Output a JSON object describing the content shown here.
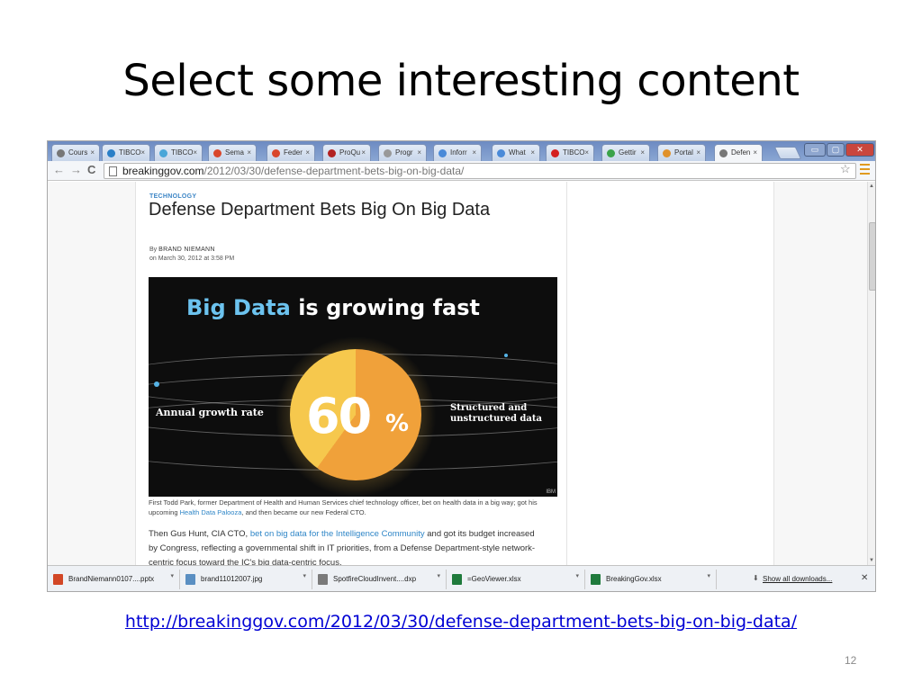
{
  "slide": {
    "title": "Select some interesting content",
    "link": "http://breakinggov.com/2012/03/30/defense-department-bets-big-on-big-data/",
    "page_number": "12"
  },
  "browser": {
    "tabs": [
      {
        "label": "Cours",
        "icon": "page-icon",
        "color": "#777777"
      },
      {
        "label": "TIBCO",
        "icon": "tibco-icon",
        "color": "#2a7fc7"
      },
      {
        "label": "TIBCO",
        "icon": "tibco-icon",
        "color": "#4aa6d8"
      },
      {
        "label": "Sema",
        "icon": "semantic-icon",
        "color": "#d9472b"
      },
      {
        "label": "Feder",
        "icon": "semantic-icon",
        "color": "#d9472b"
      },
      {
        "label": "ProQu",
        "icon": "proquest-icon",
        "color": "#b22222"
      },
      {
        "label": "Progr",
        "icon": "page-icon",
        "color": "#999999"
      },
      {
        "label": "Inforr",
        "icon": "info-icon",
        "color": "#4a8ad8"
      },
      {
        "label": "What",
        "icon": "info-icon",
        "color": "#4a8ad8"
      },
      {
        "label": "TIBCO",
        "icon": "youtube-icon",
        "color": "#d42020"
      },
      {
        "label": "Gettir",
        "icon": "chrome-icon",
        "color": "#3ba34a"
      },
      {
        "label": "Portal",
        "icon": "portal-icon",
        "color": "#e0912a"
      },
      {
        "label": "Defen",
        "icon": "breakinggov-icon",
        "color": "#777777",
        "active": true
      }
    ],
    "address": {
      "host": "breakinggov.com",
      "path": "/2012/03/30/defense-department-bets-big-on-big-data/"
    },
    "window_controls": {
      "minimize": "▭",
      "maximize": "▢",
      "close": "✕"
    }
  },
  "article": {
    "category": "TECHNOLOGY",
    "headline": "Defense Department Bets Big On Big Data",
    "byline_prefix": "By",
    "author": "BRAND NIEMANN",
    "date": "on March 30, 2012 at 3:58 PM",
    "hero": {
      "title_highlight": "Big Data",
      "title_rest": " is growing fast",
      "percent": "60",
      "percent_sign": "%",
      "percent_value": 60,
      "left_label": "Annual growth rate",
      "right_label_line1": "Structured and",
      "right_label_line2": "unstructured data",
      "credit": "IBM"
    },
    "caption": {
      "part1": "First Todd Park, former Department of Health and Human Services chief technology officer, bet on health data in a big way; got his upcoming ",
      "link": "Health Data Palooza",
      "part2": ", and then became our new Federal CTO."
    },
    "body": {
      "part1": "Then Gus Hunt, CIA CTO, ",
      "link": "bet on big data for the Intelligence Community",
      "part2": " and got its budget increased by Congress, reflecting a governmental shift in IT priorities, from a Defense Department-style network-centric focus toward the IC's big data-centric focus."
    }
  },
  "downloads": {
    "items": [
      {
        "name": "BrandNiemann0107....pptx",
        "icon": "powerpoint-file-icon",
        "color": "#d24726"
      },
      {
        "name": "brand11012007.jpg",
        "icon": "image-file-icon",
        "color": "#5a8fc2"
      },
      {
        "name": "SpotfireCloudInvent....dxp",
        "icon": "spotfire-file-icon",
        "color": "#7a7a7a"
      },
      {
        "name": "=GeoViewer.xlsx",
        "icon": "excel-file-icon",
        "color": "#1f7a3c"
      },
      {
        "name": "BreakingGov.xlsx",
        "icon": "excel-file-icon",
        "color": "#1f7a3c"
      }
    ],
    "show_all": "Show all downloads...",
    "close": "✕"
  }
}
